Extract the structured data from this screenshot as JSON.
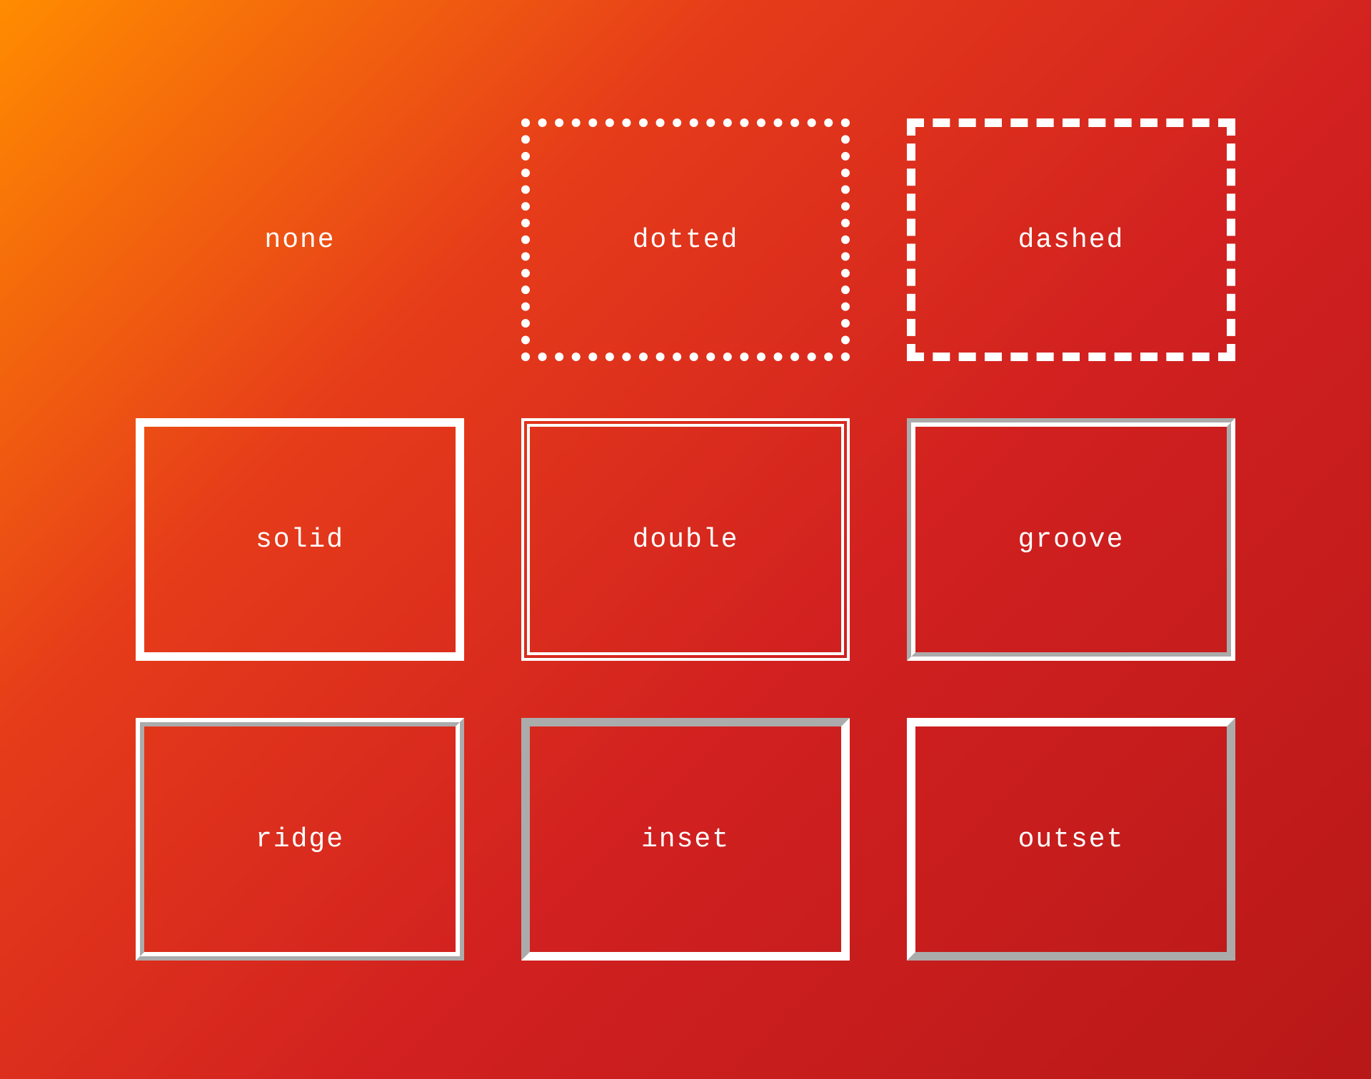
{
  "boxes": [
    {
      "label": "none",
      "style": "none"
    },
    {
      "label": "dotted",
      "style": "dotted"
    },
    {
      "label": "dashed",
      "style": "dashed"
    },
    {
      "label": "solid",
      "style": "solid"
    },
    {
      "label": "double",
      "style": "double"
    },
    {
      "label": "groove",
      "style": "groove"
    },
    {
      "label": "ridge",
      "style": "ridge"
    },
    {
      "label": "inset",
      "style": "inset"
    },
    {
      "label": "outset",
      "style": "outset"
    }
  ],
  "colors": {
    "border": "#ffffff",
    "text": "#ffffff",
    "bg_gradient_start": "#ff8c00",
    "bg_gradient_end": "#b81818"
  }
}
